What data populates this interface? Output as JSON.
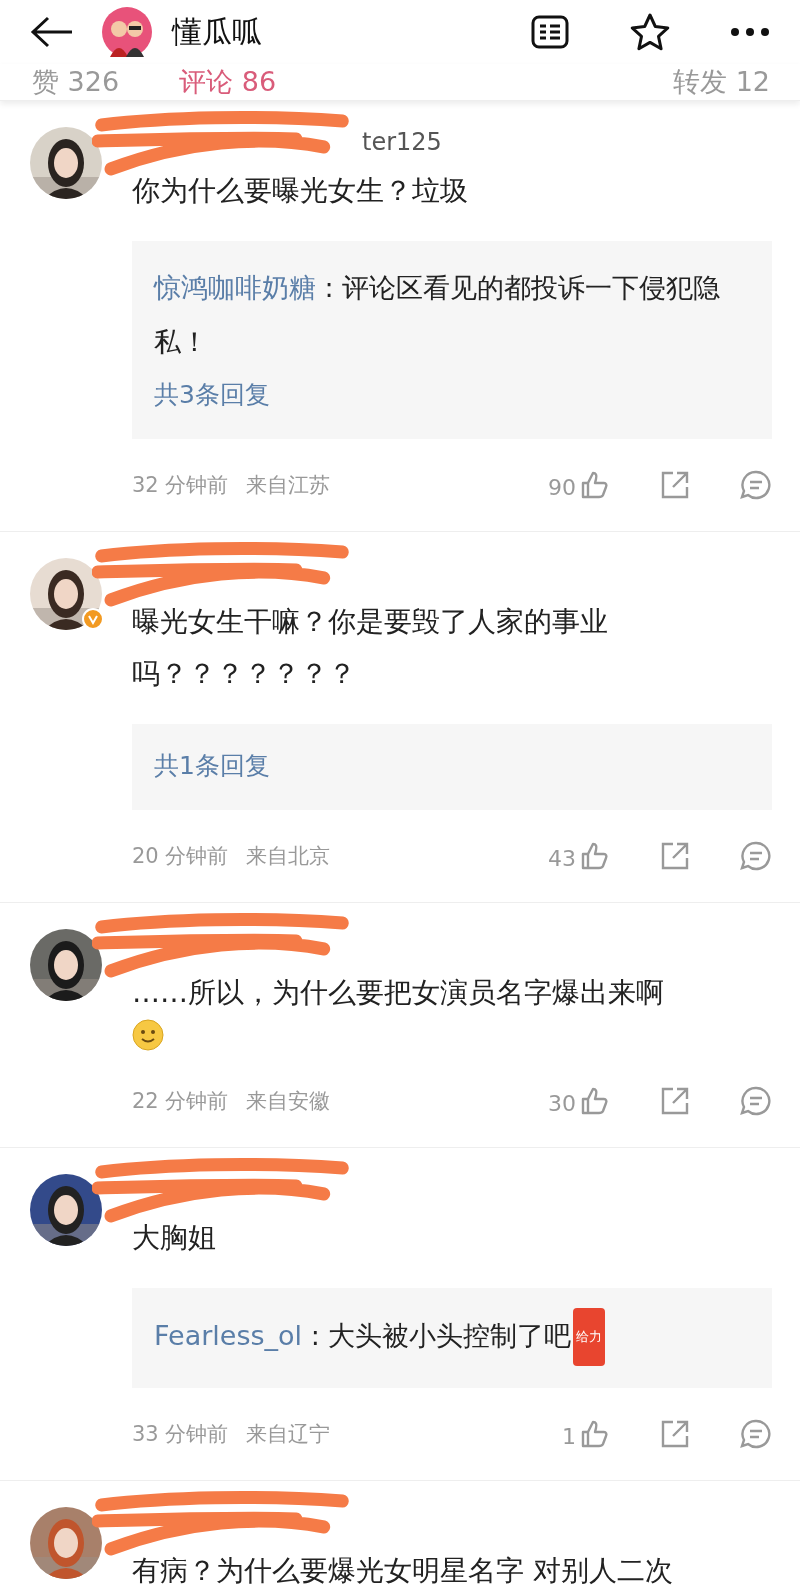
{
  "header": {
    "title": "懂瓜呱"
  },
  "tabs": [
    {
      "label": "赞 326",
      "selected": false
    },
    {
      "label": "评论 86",
      "selected": true
    },
    {
      "label": "转发 12",
      "selected": false
    }
  ],
  "comments": [
    {
      "username": "ter125",
      "lines": [
        "你为什么要曝光女生？垃圾"
      ],
      "verified": false,
      "smiley": false,
      "reply": {
        "author": "惊鸿咖啡奶糖",
        "text": " : 评论区看见的都投诉一下侵犯隐私！",
        "count": "共3条回复"
      },
      "time": "32 分钟前",
      "location": "来自江苏",
      "likes": "90"
    },
    {
      "lines": [
        "曝光女生干嘛？你是要毁了人家的事业",
        "吗？？？？？？？"
      ],
      "verified": true,
      "smiley": false,
      "reply": {
        "count": "共1条回复"
      },
      "time": "20 分钟前",
      "location": "来自北京",
      "likes": "43"
    },
    {
      "lines": [
        "……所以，为什么要把女演员名字爆出来啊"
      ],
      "verified": false,
      "smiley": true,
      "time": "22 分钟前",
      "location": "来自安徽",
      "likes": "30"
    },
    {
      "lines": [
        "大胸姐"
      ],
      "verified": false,
      "smiley": false,
      "reply": {
        "author": "Fearless_ol",
        "text": " : 大头被小头控制了吧",
        "sticker": "给力"
      },
      "time": "33 分钟前",
      "location": "来自辽宁",
      "likes": "1"
    },
    {
      "lines": [
        "有病？为什么要爆光女明星名字 对别人二次"
      ],
      "verified": false,
      "smiley": false
    }
  ]
}
